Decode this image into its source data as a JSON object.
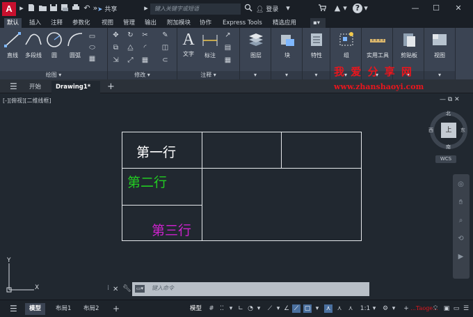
{
  "titlebar": {
    "logo": "A",
    "share_label": "共享",
    "search_placeholder": "键入关键字或短语",
    "login_label": "登录",
    "help_label": "?"
  },
  "ribbon_tabs": [
    "默认",
    "插入",
    "注释",
    "参数化",
    "视图",
    "管理",
    "输出",
    "附加模块",
    "协作",
    "Express Tools",
    "精选应用"
  ],
  "ribbon": {
    "draw": {
      "line": "直线",
      "polyline": "多段线",
      "circle": "圆",
      "arc": "圆弧",
      "footer": "绘图"
    },
    "modify": {
      "footer": "修改"
    },
    "annotation": {
      "text": "文字",
      "dimension": "标注",
      "footer": "注释"
    },
    "layers": {
      "label": "图层"
    },
    "block": {
      "label": "块"
    },
    "properties": {
      "label": "特性"
    },
    "group": {
      "label": "组"
    },
    "utilities": {
      "label": "实用工具"
    },
    "clipboard": {
      "label": "剪贴板"
    },
    "view": {
      "label": "视图"
    }
  },
  "watermark": {
    "title": "我 爱 分 享 网",
    "url": "www.zhanshaoyi.com",
    "status_text": "...Taoge..."
  },
  "filetabs": {
    "start": "开始",
    "drawing": "Drawing1*"
  },
  "viewport": {
    "label": "[-][俯视][二维线框]",
    "compass": {
      "north": "北",
      "south": "南",
      "east": "东",
      "west": "西",
      "top": "上"
    },
    "wcs": "WCS",
    "ucs_x": "X",
    "ucs_y": "Y"
  },
  "table": {
    "row1": "第一行",
    "row2": "第二行",
    "row3": "第三行",
    "colors": {
      "row1": "#ffffff",
      "row2": "#22cc22",
      "row3": "#cc22cc"
    }
  },
  "command": {
    "placeholder": "键入命令"
  },
  "statusbar": {
    "tabs": [
      "模型",
      "布局1",
      "布局2"
    ],
    "model_label": "模型",
    "scale": "1:1"
  }
}
